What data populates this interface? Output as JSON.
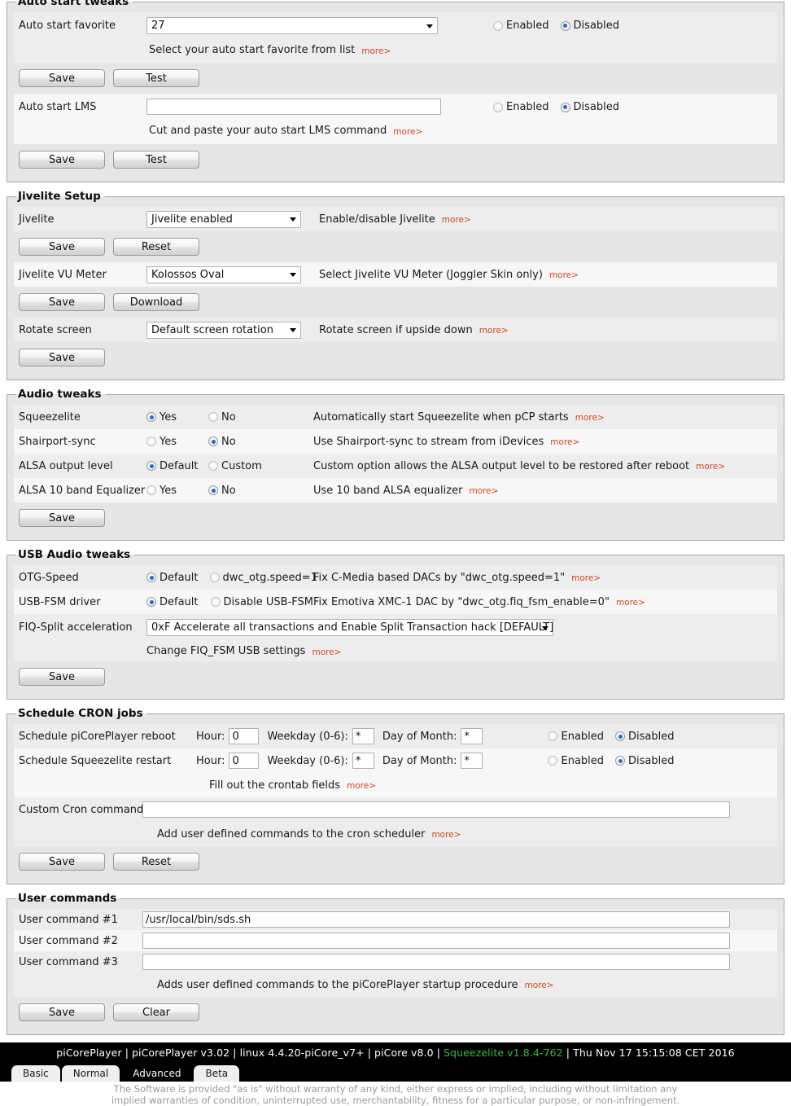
{
  "sections": {
    "autostart": {
      "legend": "Auto start tweaks",
      "favorite_label": "Auto start favorite",
      "favorite_value": "27",
      "favorite_desc": "Select your auto start favorite from list",
      "favorite_enabled_label": "Enabled",
      "favorite_disabled_label": "Disabled",
      "favorite_save": "Save",
      "favorite_test": "Test",
      "lms_label": "Auto start LMS",
      "lms_value": "",
      "lms_desc": "Cut and paste your auto start LMS command",
      "lms_enabled_label": "Enabled",
      "lms_disabled_label": "Disabled",
      "lms_save": "Save",
      "lms_test": "Test"
    },
    "jivelite": {
      "legend": "Jivelite Setup",
      "jivelite_label": "Jivelite",
      "jivelite_value": "Jivelite enabled",
      "jivelite_desc": "Enable/disable Jivelite",
      "jivelite_save": "Save",
      "jivelite_reset": "Reset",
      "vu_label": "Jivelite VU Meter",
      "vu_value": "Kolossos Oval",
      "vu_desc": "Select Jivelite VU Meter (Joggler Skin only)",
      "vu_save": "Save",
      "vu_download": "Download",
      "rotate_label": "Rotate screen",
      "rotate_value": "Default screen rotation",
      "rotate_desc": "Rotate screen if upside down",
      "rotate_save": "Save"
    },
    "audio": {
      "legend": "Audio tweaks",
      "squeezelite_label": "Squeezelite",
      "squeezelite_yes": "Yes",
      "squeezelite_no": "No",
      "squeezelite_desc": "Automatically start Squeezelite when pCP starts",
      "shairport_label": "Shairport-sync",
      "shairport_yes": "Yes",
      "shairport_no": "No",
      "shairport_desc": "Use Shairport-sync to stream from iDevices",
      "alsa_level_label": "ALSA output level",
      "alsa_level_default": "Default",
      "alsa_level_custom": "Custom",
      "alsa_level_desc": "Custom option allows the ALSA output level to be restored after reboot",
      "alsa_eq_label": "ALSA 10 band Equalizer",
      "alsa_eq_yes": "Yes",
      "alsa_eq_no": "No",
      "alsa_eq_desc": "Use 10 band ALSA equalizer",
      "save": "Save"
    },
    "usb": {
      "legend": "USB Audio tweaks",
      "otg_label": "OTG-Speed",
      "otg_default": "Default",
      "otg_alt": "dwc_otg.speed=1",
      "otg_desc": "Fix C-Media based DACs by \"dwc_otg.speed=1\"",
      "fsm_label": "USB-FSM driver",
      "fsm_default": "Default",
      "fsm_alt": "Disable USB-FSM",
      "fsm_desc": "Fix Emotiva XMC-1 DAC by \"dwc_otg.fiq_fsm_enable=0\"",
      "fiq_label": "FIQ-Split acceleration",
      "fiq_value": "0xF Accelerate all transactions and Enable Split Transaction hack [DEFAULT]",
      "fiq_desc": "Change FIQ_FSM USB settings",
      "save": "Save"
    },
    "cron": {
      "legend": "Schedule CRON jobs",
      "reboot_label": "Schedule piCorePlayer reboot",
      "reboot_hour_label": "Hour:",
      "reboot_hour_value": "0",
      "reboot_weekday_label": "Weekday (0-6):",
      "reboot_weekday_value": "*",
      "reboot_dom_label": "Day of Month:",
      "reboot_dom_value": "*",
      "reboot_enabled_label": "Enabled",
      "reboot_disabled_label": "Disabled",
      "restart_label": "Schedule Squeezelite restart",
      "restart_hour_label": "Hour:",
      "restart_hour_value": "0",
      "restart_weekday_label": "Weekday (0-6):",
      "restart_weekday_value": "*",
      "restart_dom_label": "Day of Month:",
      "restart_dom_value": "*",
      "restart_enabled_label": "Enabled",
      "restart_disabled_label": "Disabled",
      "crontab_desc": "Fill out the crontab fields",
      "custom_label": "Custom Cron command",
      "custom_value": "",
      "custom_desc": "Add user defined commands to the cron scheduler",
      "save": "Save",
      "reset": "Reset"
    },
    "usercmd": {
      "legend": "User commands",
      "cmd1_label": "User command #1",
      "cmd1_value": "/usr/local/bin/sds.sh",
      "cmd2_label": "User command #2",
      "cmd2_value": "",
      "cmd3_label": "User command #3",
      "cmd3_value": "",
      "desc": "Adds user defined commands to the piCorePlayer startup procedure",
      "save": "Save",
      "clear": "Clear"
    }
  },
  "more_label": "more>",
  "statusbar": {
    "app": "piCorePlayer",
    "version": "piCorePlayer v3.02",
    "kernel": "linux 4.4.20-piCore_v7+",
    "picore": "piCore v8.0",
    "squeezelite": "Squeezelite v1.8.4-762",
    "datetime": "Thu Nov 17 15:15:08 CET 2016",
    "separator": "|",
    "squeezelite_color": "#2fbf2f"
  },
  "tabs": [
    {
      "label": "Basic",
      "active": false
    },
    {
      "label": "Normal",
      "active": false
    },
    {
      "label": "Advanced",
      "active": true
    },
    {
      "label": "Beta",
      "active": false
    }
  ],
  "disclaimer": "The Software is provided \"as is\" without warranty of any kind, either express or implied, including without limitation any implied warranties of condition, uninterrupted use, merchantability, fitness for a particular purpose, or non-infringement."
}
